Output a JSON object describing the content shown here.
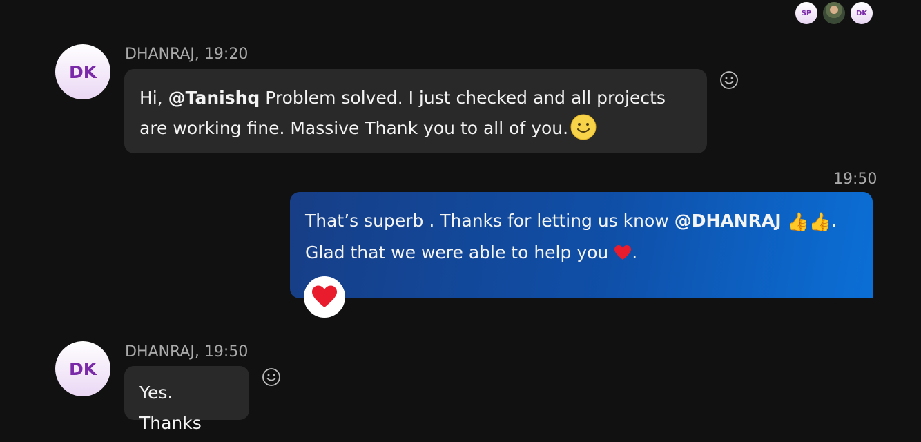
{
  "participants": [
    {
      "initials": "SP",
      "type": "initials"
    },
    {
      "initials": "",
      "type": "photo"
    },
    {
      "initials": "DK",
      "type": "initials"
    }
  ],
  "messages": [
    {
      "sender_initials": "DK",
      "meta": "DHANRAJ, 19:20",
      "greeting": "Hi, ",
      "mention": "@Tanishq",
      "text": "  Problem solved. I just checked and all projects are working fine. Massive Thank you to all of you."
    },
    {
      "meta": "19:50",
      "text_a": "That’s superb . Thanks for letting us know ",
      "mention": "@DHANRAJ",
      "text_b": ".",
      "text_c": "Glad that we were able to help you ",
      "text_d": "."
    },
    {
      "sender_initials": "DK",
      "meta": "DHANRAJ, 19:50",
      "text": "Yes. Thanks"
    }
  ],
  "icons": {
    "reaction": "smiley-outline-icon",
    "heart": "heart-icon",
    "thumbs": "thumbs-up-icon"
  },
  "colors": {
    "background": "#121112",
    "incoming_bubble": "#292929",
    "outgoing_bubble_start": "#173e86",
    "outgoing_bubble_end": "#0b6fd6",
    "avatar_text": "#7a2aa8"
  }
}
